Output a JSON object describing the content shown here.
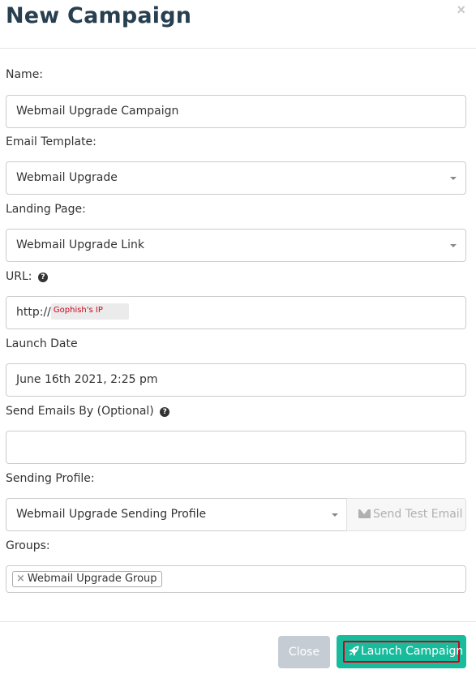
{
  "modal": {
    "title": "New Campaign",
    "close_symbol": "×"
  },
  "form": {
    "name": {
      "label": "Name:",
      "value": "Webmail Upgrade Campaign"
    },
    "email_template": {
      "label": "Email Template:",
      "value": "Webmail Upgrade"
    },
    "landing_page": {
      "label": "Landing Page:",
      "value": "Webmail Upgrade Link"
    },
    "url": {
      "label": "URL:",
      "value_prefix": "http://",
      "redaction_label": "Gophish's IP"
    },
    "launch_date": {
      "label": "Launch Date",
      "value": "June 16th 2021, 2:25 pm"
    },
    "send_by": {
      "label": "Send Emails By (Optional)",
      "value": ""
    },
    "sending_profile": {
      "label": "Sending Profile:",
      "value": "Webmail Upgrade Sending Profile",
      "test_button_label": "Send Test Email"
    },
    "groups": {
      "label": "Groups:",
      "tags": [
        "Webmail Upgrade Group"
      ],
      "tag_remove_symbol": "×"
    }
  },
  "footer": {
    "close_label": "Close",
    "launch_label": "Launch Campaign"
  },
  "icons": {
    "help": "question-circle-icon",
    "envelope": "envelope-icon",
    "rocket": "rocket-icon",
    "caret": "caret-down-icon"
  },
  "colors": {
    "title": "#283f50",
    "launch_button": "#18bc9c",
    "close_button": "#c5ccd3",
    "highlight_box": "#d0021b"
  }
}
